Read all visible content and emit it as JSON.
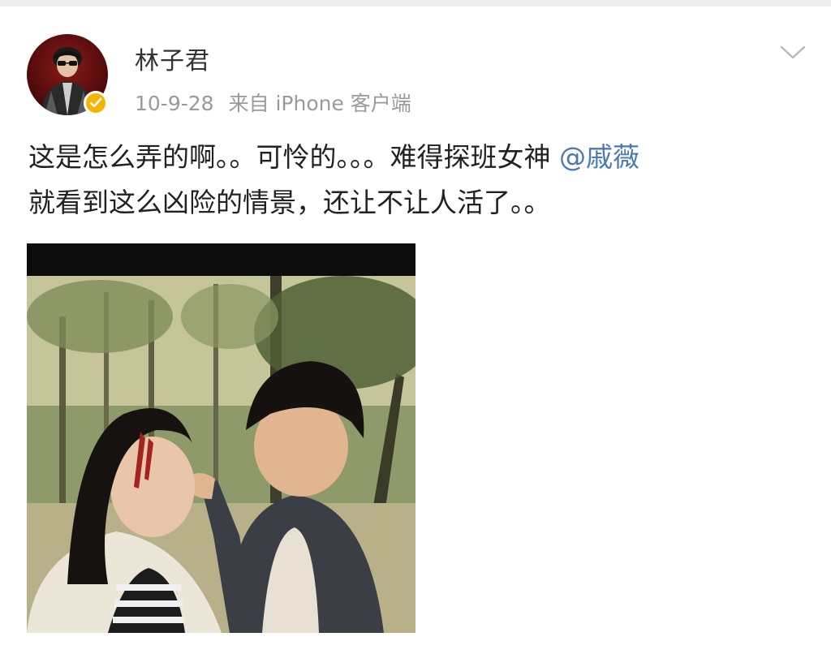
{
  "post": {
    "author": {
      "name": "林子君",
      "verified": true,
      "verified_icon": "verified-badge-icon"
    },
    "meta": {
      "date": "10-9-28",
      "source": "来自 iPhone 客户端"
    },
    "menu_icon": "chevron-down-icon",
    "text": {
      "part1": "这是怎么弄的啊。。可怜的。。。难得探班女神",
      "mention": "@戚薇",
      "part2": "就看到这么凶险的情景，还让不让人活了。。"
    }
  },
  "colors": {
    "mention": "#4a79b4",
    "verified": "#f6b400",
    "meta_text": "#9a9a9a"
  }
}
